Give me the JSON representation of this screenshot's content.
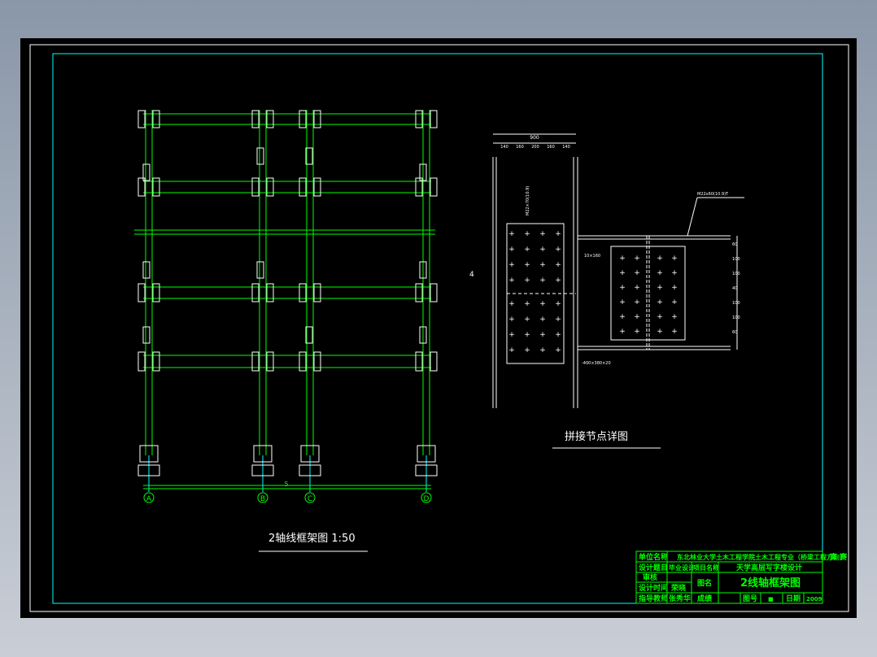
{
  "drawing": {
    "frame_title": "2轴线框架图 1:50",
    "detail_title": "拼接节点详图",
    "axes": [
      "A",
      "B",
      "C",
      "D"
    ],
    "overall_dim": "5",
    "section_mark": "4",
    "detail_labels": {
      "top_dim": "900",
      "top_subdims": [
        "140",
        "160",
        "200",
        "160",
        "140"
      ],
      "right_subdims": [
        "60",
        "100",
        "100",
        "40",
        "100",
        "100",
        "60"
      ],
      "note_top": "M22x60(10.9)T",
      "note_left": "10×160",
      "note_bottom": "-400×380×20",
      "note_vertical": "M22×70(10.9)"
    }
  },
  "title_block": {
    "unit_label": "单位名称",
    "unit_value": "东北林业大学土木工程学院土木工程专业（桥梁工程方向）",
    "design_topic_label": "设计题目",
    "design_topic_value": "毕业设计",
    "project_label": "项目名称",
    "project_value": "天学高层写字楼设计",
    "review_label": "审核",
    "design_time_label": "设计时间",
    "designer": "荣晓",
    "drawing_name_label": "图名",
    "drawing_name_value": "2线轴框架图",
    "advisor_label": "指导教师",
    "advisor_value": "张秀华",
    "grade_label": "成绩",
    "drawing_no_label": "图号",
    "drawing_no_value": "■",
    "date_label": "日期",
    "date_value": "2009",
    "side_note": "真 赛"
  }
}
